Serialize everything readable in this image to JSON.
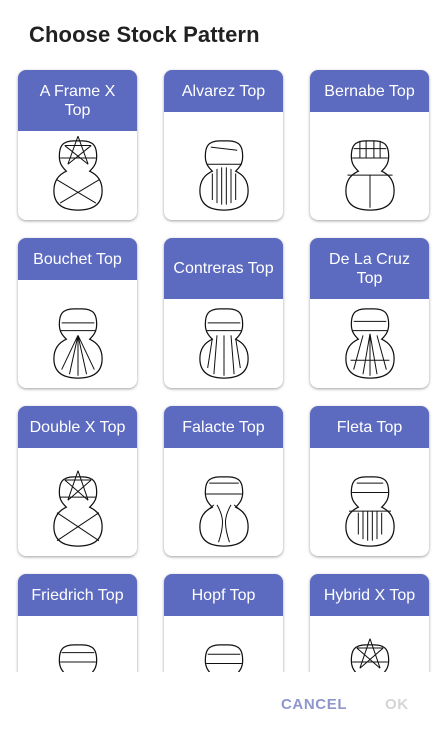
{
  "dialog": {
    "title": "Choose Stock Pattern"
  },
  "patterns": [
    {
      "label": "A Frame X Top",
      "icon": "a-frame-x-top-bracing-icon"
    },
    {
      "label": "Alvarez Top",
      "icon": "alvarez-top-bracing-icon"
    },
    {
      "label": "Bernabe Top",
      "icon": "bernabe-top-bracing-icon"
    },
    {
      "label": "Bouchet Top",
      "icon": "bouchet-top-bracing-icon"
    },
    {
      "label": "Contreras Top",
      "icon": "contreras-top-bracing-icon"
    },
    {
      "label": "De La Cruz Top",
      "icon": "de-la-cruz-top-bracing-icon"
    },
    {
      "label": "Double X Top",
      "icon": "double-x-top-bracing-icon"
    },
    {
      "label": "Falacte Top",
      "icon": "falacte-top-bracing-icon"
    },
    {
      "label": "Fleta Top",
      "icon": "fleta-top-bracing-icon"
    },
    {
      "label": "Friedrich Top",
      "icon": "friedrich-top-bracing-icon"
    },
    {
      "label": "Hopf Top",
      "icon": "hopf-top-bracing-icon"
    },
    {
      "label": "Hybrid X Top",
      "icon": "hybrid-x-top-bracing-icon"
    }
  ],
  "actions": {
    "cancel": "CANCEL",
    "ok": "OK"
  },
  "colors": {
    "header": "#5c6bc0",
    "cancel": "#8f96cc",
    "ok_disabled": "#d4d4d4",
    "title": "#212121"
  }
}
